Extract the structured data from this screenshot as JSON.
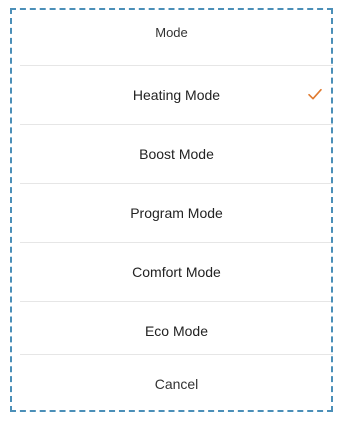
{
  "sheet": {
    "title": "Mode",
    "options": [
      {
        "label": "Heating Mode",
        "selected": true
      },
      {
        "label": "Boost Mode",
        "selected": false
      },
      {
        "label": "Program Mode",
        "selected": false
      },
      {
        "label": "Comfort Mode",
        "selected": false
      },
      {
        "label": "Eco Mode",
        "selected": false
      }
    ],
    "cancel_label": "Cancel",
    "check_icon": "checkmark-icon"
  },
  "colors": {
    "check": "#e07a2f",
    "frame": "#4b8fb8",
    "accent_bar": "#8fc24a",
    "divider": "#e6e6e6"
  }
}
